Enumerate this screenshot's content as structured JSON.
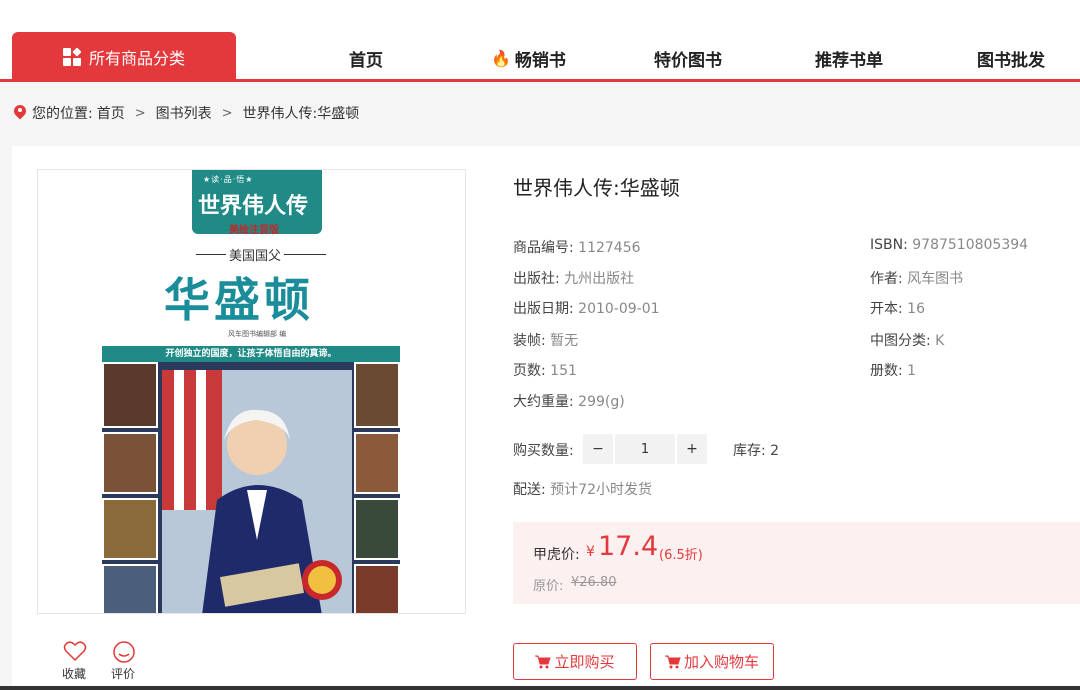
{
  "nav": {
    "all_categories": "所有商品分类",
    "items": [
      "首页",
      "畅销书",
      "特价图书",
      "推荐书单",
      "图书批发"
    ]
  },
  "breadcrumb": {
    "prefix": "您的位置:",
    "items": [
      "首页",
      "图书列表",
      "世界伟人传:华盛顿"
    ],
    "separator": ">"
  },
  "cover": {
    "badge": "★读·品·悟★",
    "series_title": "世界伟人传",
    "edition": "美绘注音版",
    "small_name": "美国国父",
    "name": "华盛顿",
    "credit": "风车图书编辑部 编",
    "slogan": "开创独立的国度，让孩子体悟自由的真谛。"
  },
  "product": {
    "title": "世界伟人传:华盛顿",
    "specs_left": [
      {
        "label": "商品编号:",
        "value": "1127456"
      },
      {
        "label": "出版社:",
        "value": "九州出版社"
      },
      {
        "label": "出版日期:",
        "value": "2010-09-01"
      },
      {
        "label": "装帧:",
        "value": "暂无"
      },
      {
        "label": "页数:",
        "value": "151"
      },
      {
        "label": "大约重量:",
        "value": "299(g)"
      }
    ],
    "specs_right": [
      {
        "label": "ISBN:",
        "value": "9787510805394"
      },
      {
        "label": "作者:",
        "value": "风车图书"
      },
      {
        "label": "开本:",
        "value": "16"
      },
      {
        "label": "中图分类:",
        "value": "K"
      },
      {
        "label": "册数:",
        "value": "1"
      }
    ],
    "qty_label": "购买数量:",
    "qty_minus": "−",
    "qty_value": "1",
    "qty_plus": "+",
    "stock": "库存: 2",
    "ship_label": "配送:",
    "ship_value": "预计72小时发货"
  },
  "price": {
    "label": "甲虎价:",
    "currency": "¥",
    "value": "17.4",
    "discount": "(6.5折)",
    "orig_label": "原价:",
    "orig_value": "¥26.80"
  },
  "actions": {
    "buy_now": "立即购买",
    "add_cart": "加入购物车",
    "favorite": "收藏",
    "review": "评价"
  },
  "colors": {
    "accent": "#e4393c",
    "price_bg": "#fdf0f0",
    "cover_teal": "#1f8a86"
  }
}
